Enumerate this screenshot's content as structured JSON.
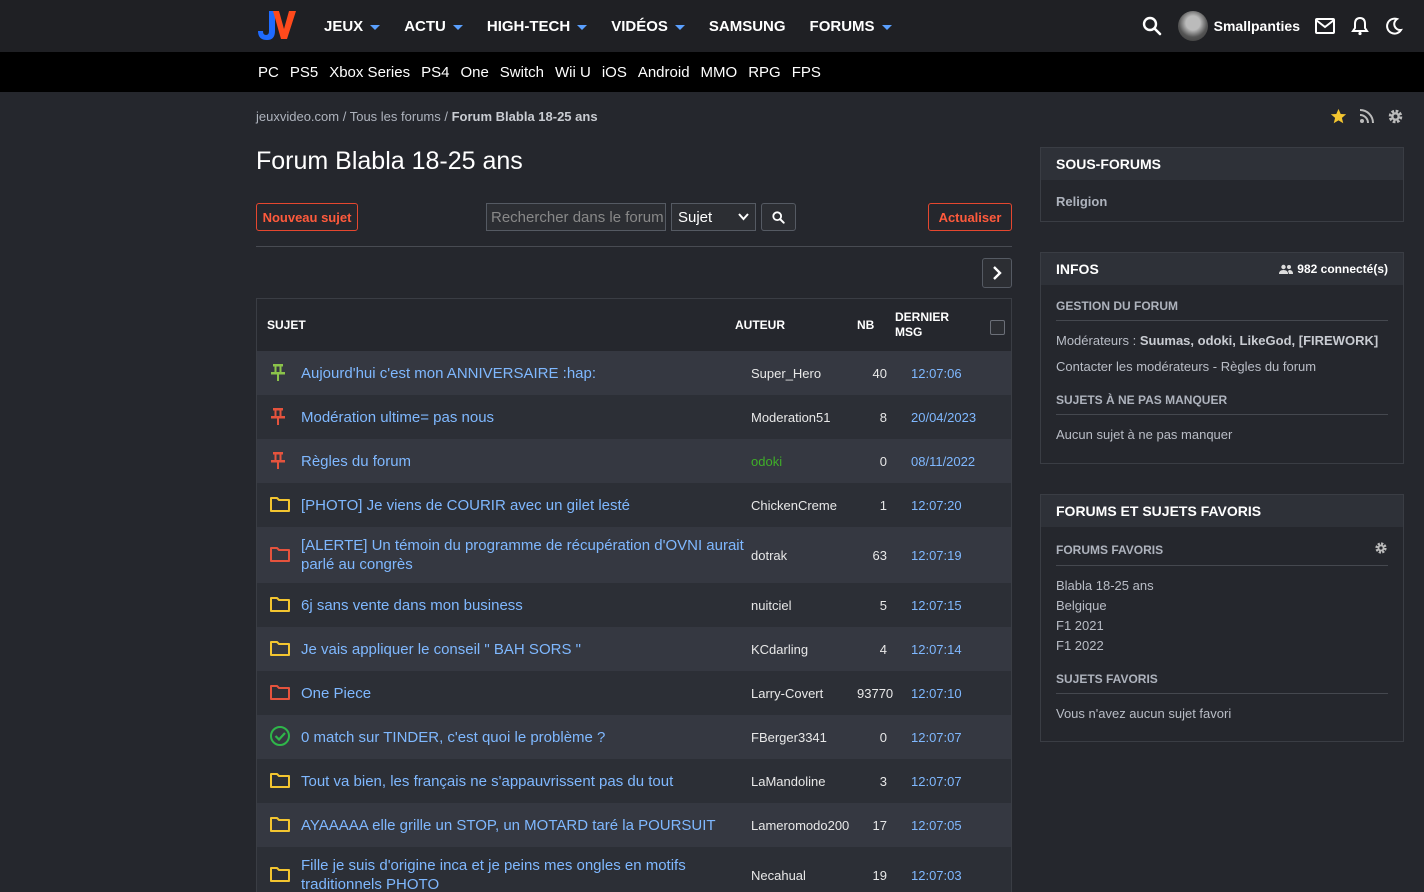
{
  "nav": {
    "logo": "JV",
    "items": [
      {
        "label": "JEUX",
        "caret": true
      },
      {
        "label": "ACTU",
        "caret": true
      },
      {
        "label": "HIGH-TECH",
        "caret": true
      },
      {
        "label": "VIDÉOS",
        "caret": true
      },
      {
        "label": "SAMSUNG",
        "caret": false
      },
      {
        "label": "FORUMS",
        "caret": true
      }
    ],
    "username": "Smallpanties"
  },
  "subnav": [
    "PC",
    "PS5",
    "Xbox Series",
    "PS4",
    "One",
    "Switch",
    "Wii U",
    "iOS",
    "Android",
    "MMO",
    "RPG",
    "FPS"
  ],
  "breadcrumb": {
    "site": "jeuxvideo.com",
    "sep1": " / ",
    "forums": "Tous les forums",
    "sep2": " / ",
    "current": "Forum Blabla 18-25 ans"
  },
  "page_title": "Forum Blabla 18-25 ans",
  "toolbar": {
    "new_topic": "Nouveau sujet",
    "search_placeholder": "Rechercher dans le forum",
    "select_value": "Sujet",
    "refresh": "Actualiser"
  },
  "table": {
    "headers": {
      "subject": "SUJET",
      "author": "AUTEUR",
      "nb": "NB",
      "last": "DERNIER MSG"
    },
    "rows": [
      {
        "icon": "pin-green",
        "subject": "Aujourd'hui c'est mon ANNIVERSAIRE :hap:",
        "author": "Super_Hero",
        "nb": "40",
        "last": "12:07:06"
      },
      {
        "icon": "pin-red",
        "subject": "Modération ultime= pas nous",
        "author": "Moderation51",
        "nb": "8",
        "last": "20/04/2023"
      },
      {
        "icon": "pin-red",
        "subject": "Règles du forum",
        "author": "odoki",
        "author_color": "#3fae29",
        "nb": "0",
        "last": "08/11/2022"
      },
      {
        "icon": "folder-yellow",
        "subject": "[PHOTO] Je viens de COURIR avec un gilet lesté",
        "author": "ChickenCreme",
        "nb": "1",
        "last": "12:07:20"
      },
      {
        "icon": "folder-red",
        "subject": "[ALERTE] Un témoin du programme de récupération d'OVNI aurait parlé au congrès",
        "author": "dotrak",
        "nb": "63",
        "last": "12:07:19"
      },
      {
        "icon": "folder-yellow",
        "subject": "6j sans vente dans mon business",
        "author": "nuitciel",
        "nb": "5",
        "last": "12:07:15"
      },
      {
        "icon": "folder-yellow",
        "subject": "Je vais appliquer le conseil \" BAH SORS \"",
        "author": "KCdarling",
        "nb": "4",
        "last": "12:07:14"
      },
      {
        "icon": "folder-red",
        "subject": "One Piece",
        "author": "Larry-Covert",
        "nb": "93770",
        "last": "12:07:10"
      },
      {
        "icon": "check-green",
        "subject": "0 match sur TINDER, c'est quoi le problème ?",
        "author": "FBerger3341",
        "nb": "0",
        "last": "12:07:07"
      },
      {
        "icon": "folder-yellow",
        "subject": "Tout va bien, les français ne s'appauvrissent pas du tout",
        "author": "LaMandoline",
        "nb": "3",
        "last": "12:07:07"
      },
      {
        "icon": "folder-yellow",
        "subject": "AYAAAAA elle grille un STOP, un MOTARD taré la POURSUIT",
        "author": "Lameromodo200",
        "nb": "17",
        "last": "12:07:05"
      },
      {
        "icon": "folder-yellow",
        "subject": "Fille je suis d'origine inca et je peins mes ongles en motifs traditionnels PHOTO",
        "author": "Necahual",
        "nb": "19",
        "last": "12:07:03"
      }
    ]
  },
  "sidebar": {
    "subforums": {
      "title": "SOUS-FORUMS",
      "items": [
        "Religion"
      ]
    },
    "infos": {
      "title": "INFOS",
      "connected": "982 connecté(s)",
      "management_title": "GESTION DU FORUM",
      "moderators_label": "Modérateurs : ",
      "moderators": "Suumas, odoki, LikeGod, [FIREWORK]",
      "contact": "Contacter les modérateurs - Règles du forum",
      "must_read_title": "SUJETS À NE PAS MANQUER",
      "must_read_empty": "Aucun sujet à ne pas manquer"
    },
    "favorites": {
      "title": "FORUMS ET SUJETS FAVORIS",
      "forums_title": "FORUMS FAVORIS",
      "forums": [
        "Blabla 18-25 ans",
        "Belgique",
        "F1 2021",
        "F1 2022"
      ],
      "topics_title": "SUJETS FAVORIS",
      "topics_empty": "Vous n'avez aucun sujet favori"
    }
  },
  "colors": {
    "accent": "#5aa0ff",
    "link": "#7fb8ff",
    "danger": "#ff5a3c",
    "mod": "#3fae29",
    "folder_yellow": "#f3c530",
    "folder_red": "#e5533d",
    "pin_green": "#8bc34a"
  }
}
